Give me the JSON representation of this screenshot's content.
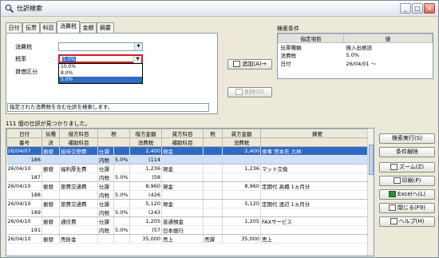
{
  "window": {
    "title": "仕訳検索"
  },
  "tabs": [
    "日付",
    "伝票",
    "科目",
    "消費税",
    "金額",
    "摘要"
  ],
  "filter": {
    "tax_label": "消費税",
    "rate_label": "税率",
    "rate_value": "5.0%",
    "lend_label": "貸借区分",
    "dropdown_options": [
      "10.0%",
      "8.0%",
      "5.0%"
    ],
    "hint": "指定された消費税を含む仕訳を検索します。"
  },
  "buttons": {
    "add": "追加(A)→",
    "delete": "削除(D)"
  },
  "conditions": {
    "label": "検索条件",
    "headers": [
      "指定項目",
      "値"
    ],
    "rows": [
      [
        "伝票種類",
        "振入出帳読"
      ],
      [
        "消費税",
        "5.0%"
      ],
      [
        "日付",
        "26/04/01 ～"
      ]
    ]
  },
  "results": {
    "count_text": "111 個の仕訳が見つかりました。",
    "headers1": [
      "日付",
      "伝種",
      "借方科目",
      "税",
      "借方金額",
      "貸方科目",
      "税",
      "貸方金額",
      "摘要"
    ],
    "headers2": [
      "番号",
      "決",
      "補助科目",
      "",
      "消費税",
      "補助科目",
      "",
      "消費税",
      ""
    ],
    "rows": [
      [
        "26/04/07",
        "振替",
        "接待交際費",
        "仕課",
        "",
        "2,400",
        "現金",
        "",
        "2,400",
        "食事 宮本氏 大林"
      ],
      [
        "186",
        "",
        "",
        "内税",
        "5.0%",
        "(114",
        "",
        "",
        "",
        ""
      ],
      [
        "26/04/10",
        "振替",
        "福利厚生費",
        "仕課",
        "",
        "1,236",
        "現金",
        "",
        "1,236",
        "マット交換"
      ],
      [
        "187",
        "",
        "",
        "内税",
        "5.0%",
        "(58",
        "",
        "",
        "",
        ""
      ],
      [
        "26/04/10",
        "振替",
        "旅費交通費",
        "仕課",
        "",
        "8,960",
        "現金",
        "",
        "8,960",
        "定期代 高橋 1ヵ月分"
      ],
      [
        "188",
        "",
        "",
        "内税",
        "5.0%",
        "(426",
        "",
        "",
        "",
        ""
      ],
      [
        "26/04/10",
        "振替",
        "旅費交通費",
        "仕課",
        "",
        "5,120",
        "現金",
        "",
        "5,120",
        "定期代 渡辺 1ヵ月分"
      ],
      [
        "189",
        "",
        "",
        "内税",
        "5.0%",
        "(243",
        "",
        "",
        "",
        ""
      ],
      [
        "26/04/10",
        "振替",
        "通信費",
        "仕課",
        "",
        "1,205",
        "普通預金",
        "",
        "1,205",
        "FAXサービス"
      ],
      [
        "191",
        "",
        "",
        "内税",
        "5.0%",
        "(57",
        "日本銀行",
        "",
        "",
        ""
      ],
      [
        "26/04/10",
        "振替",
        "売掛金",
        "",
        "",
        "35,000",
        "売上",
        "売課",
        "35,000",
        "売上"
      ]
    ]
  },
  "side_buttons": [
    "検索実行(S)",
    "条件解除",
    "ズーム(Z)",
    "印刷(P)",
    "Excelへ(L)",
    "閉じる(F9)",
    "ヘルプ(H)"
  ]
}
